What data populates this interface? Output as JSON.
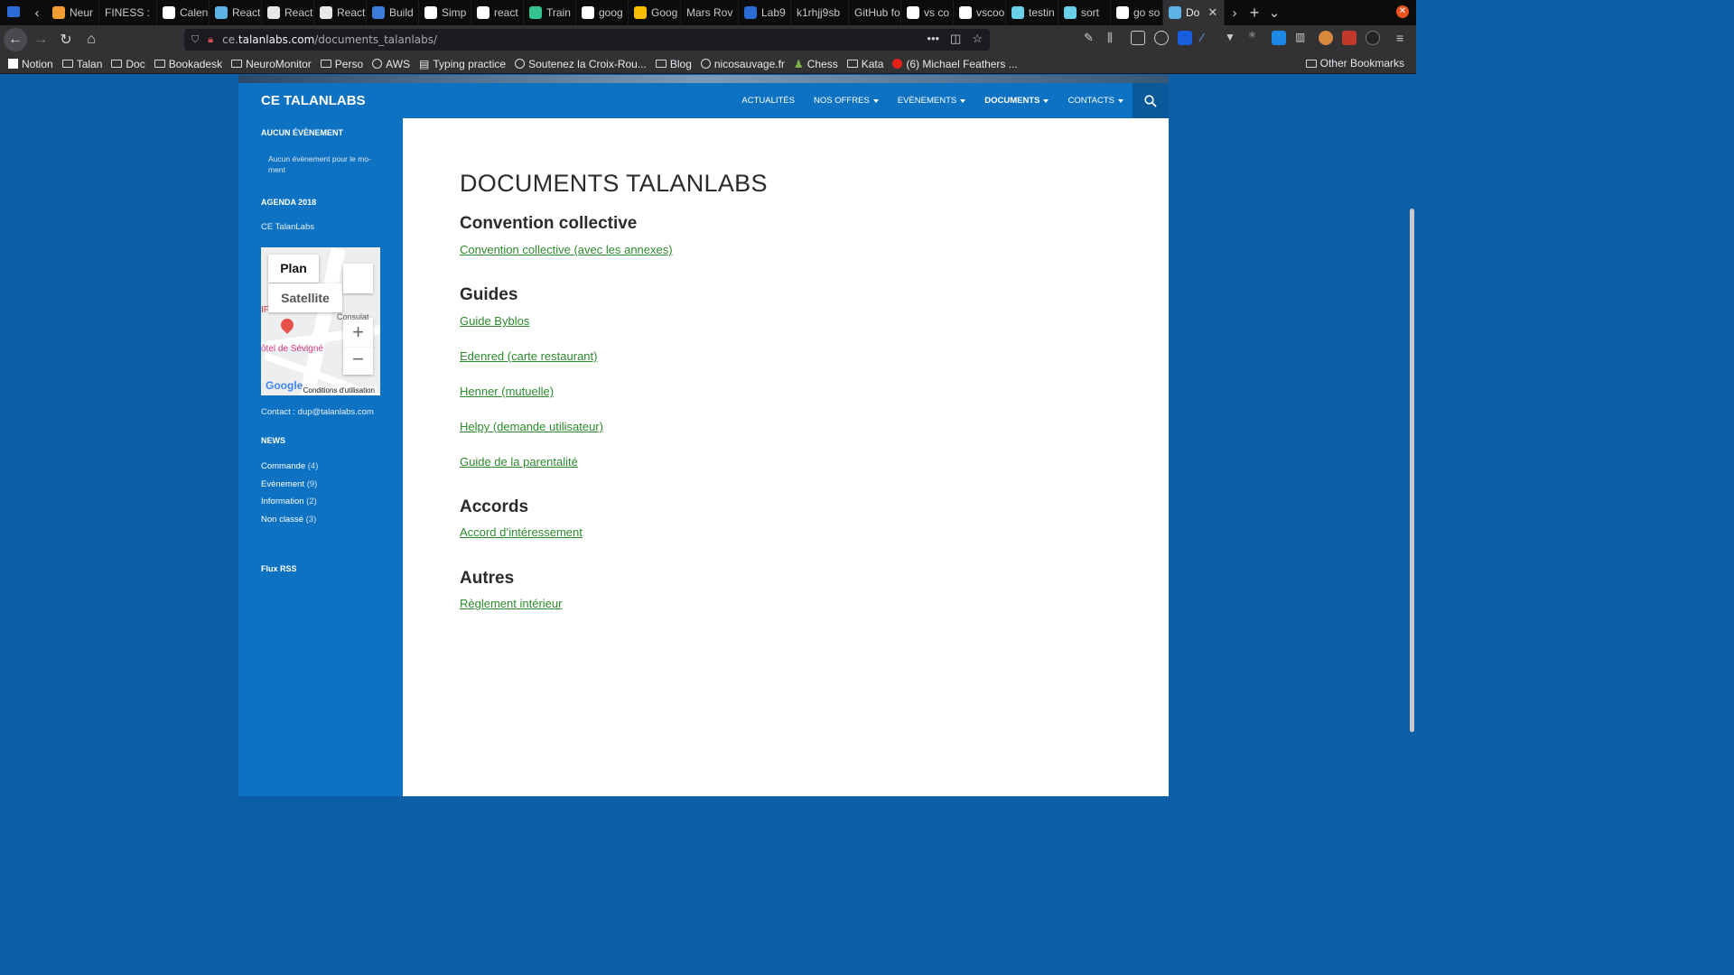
{
  "browser": {
    "tabs": [
      {
        "label": "Neur",
        "color": "#f39c34"
      },
      {
        "label": "FINESS :",
        "color": ""
      },
      {
        "label": "Calen",
        "color": "#ffffff"
      },
      {
        "label": "React",
        "color": "#5cb4e6"
      },
      {
        "label": "React",
        "color": "#e8e8e8"
      },
      {
        "label": "React",
        "color": "#e8e8e8"
      },
      {
        "label": "Build",
        "color": "#3d7bd9"
      },
      {
        "label": "Simp",
        "color": "#ffffff"
      },
      {
        "label": "react",
        "color": "#ffffff"
      },
      {
        "label": "Train",
        "color": "#34c38f"
      },
      {
        "label": "goog",
        "color": "#ffffff"
      },
      {
        "label": "Goog",
        "color": "#fbbc05"
      },
      {
        "label": "Mars Rov",
        "color": ""
      },
      {
        "label": "Lab9",
        "color": "#2a6bd6"
      },
      {
        "label": "k1rhjj9sb",
        "color": ""
      },
      {
        "label": "GitHub fo",
        "color": ""
      },
      {
        "label": "vs co",
        "color": "#ffffff"
      },
      {
        "label": "vscoo",
        "color": "#ffffff"
      },
      {
        "label": "testin",
        "color": "#6ad0e8"
      },
      {
        "label": "sort",
        "color": "#6ad0e8"
      },
      {
        "label": "go so",
        "color": "#ffffff"
      },
      {
        "label": "Do",
        "color": "#5cb4e6"
      }
    ],
    "url_prefix": "ce.",
    "url_domain": "talanlabs.com",
    "url_path": "/documents_talanlabs/",
    "bookmarks": [
      {
        "label": "Notion",
        "icon": "notion-icon"
      },
      {
        "label": "Talan",
        "icon": "folder-icon"
      },
      {
        "label": "Doc",
        "icon": "folder-icon"
      },
      {
        "label": "Bookadesk",
        "icon": "folder-icon"
      },
      {
        "label": "NeuroMonitor",
        "icon": "folder-icon"
      },
      {
        "label": "Perso",
        "icon": "folder-icon"
      },
      {
        "label": "AWS",
        "icon": "globe-icon"
      },
      {
        "label": "Typing practice",
        "icon": "page-icon"
      },
      {
        "label": "Soutenez la Croix-Rou...",
        "icon": "globe-icon"
      },
      {
        "label": "Blog",
        "icon": "folder-icon"
      },
      {
        "label": "nicosauvage.fr",
        "icon": "globe-icon"
      },
      {
        "label": "Chess",
        "icon": "pawn-icon"
      },
      {
        "label": "Kata",
        "icon": "folder-icon"
      },
      {
        "label": "(6) Michael Feathers ...",
        "icon": "youtube-icon"
      }
    ],
    "other_bookmarks": "Other Bookmarks"
  },
  "site": {
    "title": "CE TALANLABS",
    "menu": [
      {
        "label": "ACTUALITÉS",
        "dropdown": false,
        "current": false
      },
      {
        "label": "NOS OFFRES",
        "dropdown": true,
        "current": false
      },
      {
        "label": "EVÈNEMENTS",
        "dropdown": true,
        "current": false
      },
      {
        "label": "DOCUMENTS",
        "dropdown": true,
        "current": true
      },
      {
        "label": "CONTACTS",
        "dropdown": true,
        "current": false
      }
    ]
  },
  "sidebar": {
    "events_title": "AUCUN ÉVÈNEMENT",
    "events_text": "Aucun évènement pour le mo­ment",
    "agenda_title": "AGENDA 2018",
    "agenda_link": "CE TalanLabs",
    "map": {
      "plan": "Plan",
      "satellite": "Satellite",
      "place_label": "ôtel de Sévigné",
      "street_label": "Consulat",
      "terms": "Conditions d'utilisation",
      "logo": "Google",
      "ip_label": "IF"
    },
    "contact": "Contact : dup@talanlabs.com",
    "news_title": "NEWS",
    "categories": [
      {
        "name": "Commande",
        "count": "(4)"
      },
      {
        "name": "Evènement",
        "count": "(9)"
      },
      {
        "name": "Information",
        "count": "(2)"
      },
      {
        "name": "Non classé",
        "count": "(3)"
      }
    ],
    "rss": "Flux RSS"
  },
  "content": {
    "title": "DOCUMENTS TALANLABS",
    "sections": [
      {
        "heading": "Convention collective",
        "links": [
          "Convention collective (avec les annexes)"
        ]
      },
      {
        "heading": "Guides",
        "links": [
          "Guide Byblos",
          "Edenred (carte restaurant)",
          "Henner (mutuelle)",
          "Helpy (demande utilisateur)",
          "Guide de la parentalité"
        ]
      },
      {
        "heading": "Accords",
        "links": [
          "Accord d’intéressement"
        ]
      },
      {
        "heading": "Autres",
        "links": [
          "Règlement intérieur"
        ]
      }
    ]
  },
  "colors": {
    "page_bg": "#0c5fa6",
    "nav_bg": "#0e72c3",
    "link": "#2c8a2c"
  }
}
